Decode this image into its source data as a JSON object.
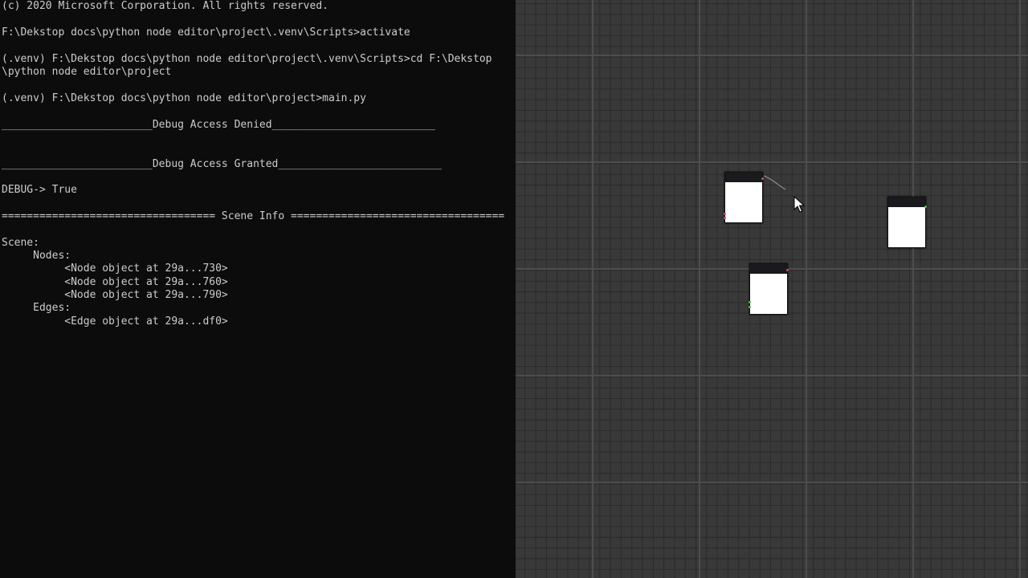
{
  "terminal": {
    "lines": [
      "(c) 2020 Microsoft Corporation. All rights reserved.",
      "",
      "F:\\Dekstop docs\\python node editor\\project\\.venv\\Scripts>activate",
      "",
      "(.venv) F:\\Dekstop docs\\python node editor\\project\\.venv\\Scripts>cd F:\\Dekstop",
      "\\python node editor\\project",
      "",
      "(.venv) F:\\Dekstop docs\\python node editor\\project>main.py",
      "",
      "________________________Debug Access Denied__________________________",
      "",
      "",
      "________________________Debug Access Granted__________________________",
      "",
      "DEBUG-> True",
      "",
      "================================== Scene Info ==================================",
      "",
      "Scene:",
      "     Nodes:",
      "          <Node object at 29a...730>",
      "          <Node object at 29a...760>",
      "          <Node object at 29a...790>",
      "     Edges:",
      "          <Edge object at 29a...df0>"
    ]
  },
  "editor": {
    "colors": {
      "background": "#393939",
      "grid_minor": "#2a2a2a",
      "grid_major": "#4d4d4d",
      "node_title": "#1a1a1e",
      "node_body": "#ffffff",
      "socket_input": "#d04a6a",
      "socket_output": "#4ac05a",
      "edge": "#8a8a8a"
    },
    "cursor_icon": "arrow-cursor-icon"
  }
}
